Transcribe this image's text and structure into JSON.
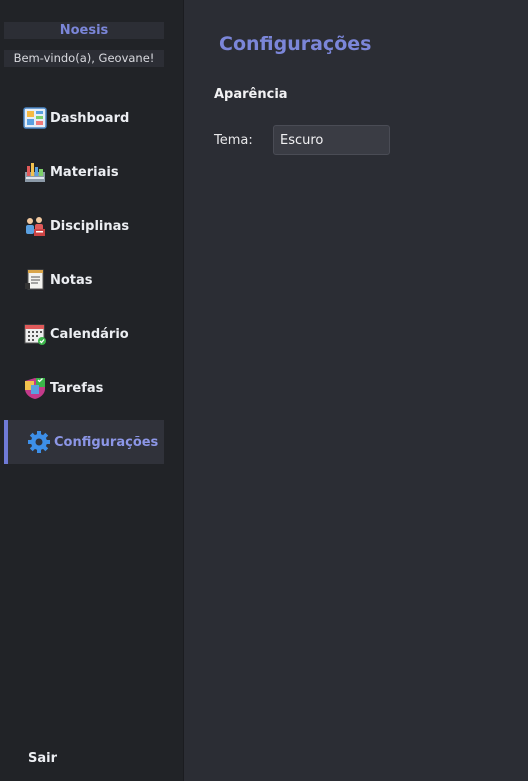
{
  "sidebar": {
    "brand": "Noesis",
    "welcome": "Bem-vindo(a), Geovane!",
    "items": [
      {
        "label": "Dashboard",
        "icon": "dashboard-icon"
      },
      {
        "label": "Materiais",
        "icon": "materials-icon"
      },
      {
        "label": "Disciplinas",
        "icon": "disciplines-icon"
      },
      {
        "label": "Notas",
        "icon": "notes-icon"
      },
      {
        "label": "Calendário",
        "icon": "calendar-icon"
      },
      {
        "label": "Tarefas",
        "icon": "tasks-icon"
      },
      {
        "label": "Configurações",
        "icon": "gear-icon",
        "active": true
      }
    ],
    "logout": "Sair"
  },
  "main": {
    "title": "Configurações",
    "section": "Aparência",
    "theme_label": "Tema:",
    "theme_value": "Escuro"
  },
  "colors": {
    "accent": "#7b86d9",
    "sidebar_bg": "#212327",
    "main_bg": "#2b2d34"
  }
}
